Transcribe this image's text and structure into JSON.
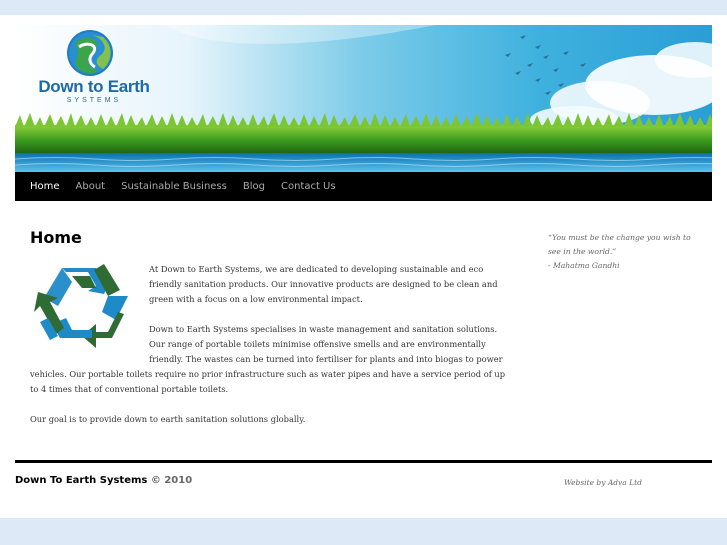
{
  "logo": {
    "wordmark": "Down to Earth",
    "sub": "SYSTEMS"
  },
  "nav": {
    "items": [
      "Home",
      "About",
      "Sustainable Business",
      "Blog",
      "Contact Us"
    ],
    "current": "Home"
  },
  "main": {
    "title": "Home",
    "paragraphs": [
      "At Down to Earth Systems, we are dedicated to developing sustainable and eco friendly sanitation products. Our innovative products are designed to be clean and green with a focus on a low environmental impact.",
      "Down to Earth Systems specialises in waste management and sanitation solutions. Our range of portable toilets minimise offensive smells and are environmentally friendly. The wastes can be turned into fertiliser for plants and into biogas to power vehicles. Our portable toilets require no prior infrastructure such as water pipes and have a service period of up to 4 times that of conventional portable toilets.",
      "Our goal is to provide down to earth sanitation solutions globally."
    ]
  },
  "sidebar": {
    "quote": "“You must be the change you wish to see in the world.”",
    "attribution": "- Mahatma Gandhi"
  },
  "footer": {
    "site_name": "Down To Earth Systems",
    "copyright": "© 2010",
    "credit": "Website by Adva Ltd"
  },
  "colors": {
    "page_bg": "#dde9f7",
    "nav_bg": "#000000",
    "brand_blue": "#1e6aa8",
    "brand_green": "#2e7d32",
    "recycle_blue": "#1f8ac8",
    "recycle_green": "#2f6b34"
  }
}
